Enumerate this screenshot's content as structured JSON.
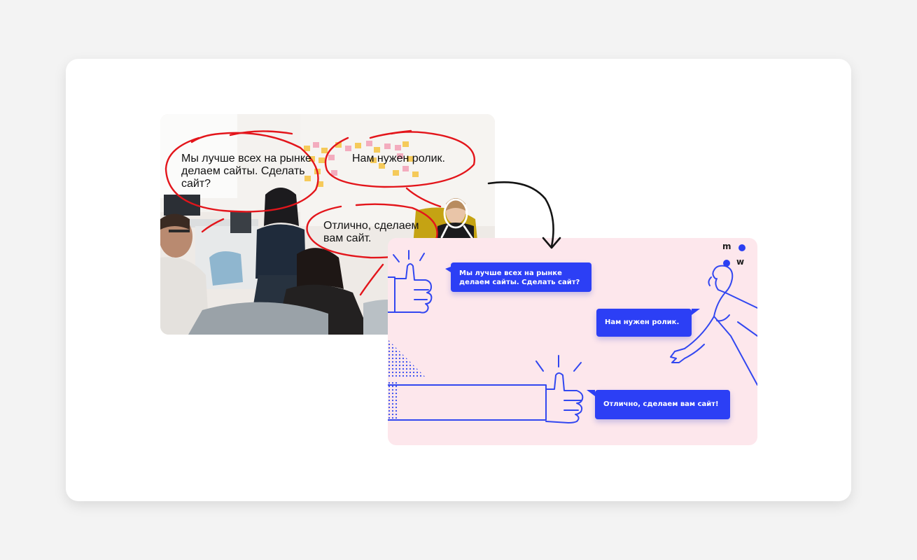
{
  "photo": {
    "notes": [
      "Мы лучше всех на рынке делаем сайты. Сделать сайт?",
      "Нам нужен ролик.",
      "Отлично, сделаем вам сайт."
    ]
  },
  "illustration": {
    "logo_top": "m",
    "logo_bottom": "w",
    "messages": [
      "Мы лучше всех на рынке делаем сайты. Сделать сайт?",
      "Нам нужен ролик.",
      "Отлично, сделаем вам сайт!"
    ]
  },
  "colors": {
    "background": "#f3f3f3",
    "card": "#ffffff",
    "annotation_red": "#e3151b",
    "bubble_blue": "#2c3ff5",
    "illustration_bg": "#fde7ec",
    "line_blue": "#3247f0"
  }
}
